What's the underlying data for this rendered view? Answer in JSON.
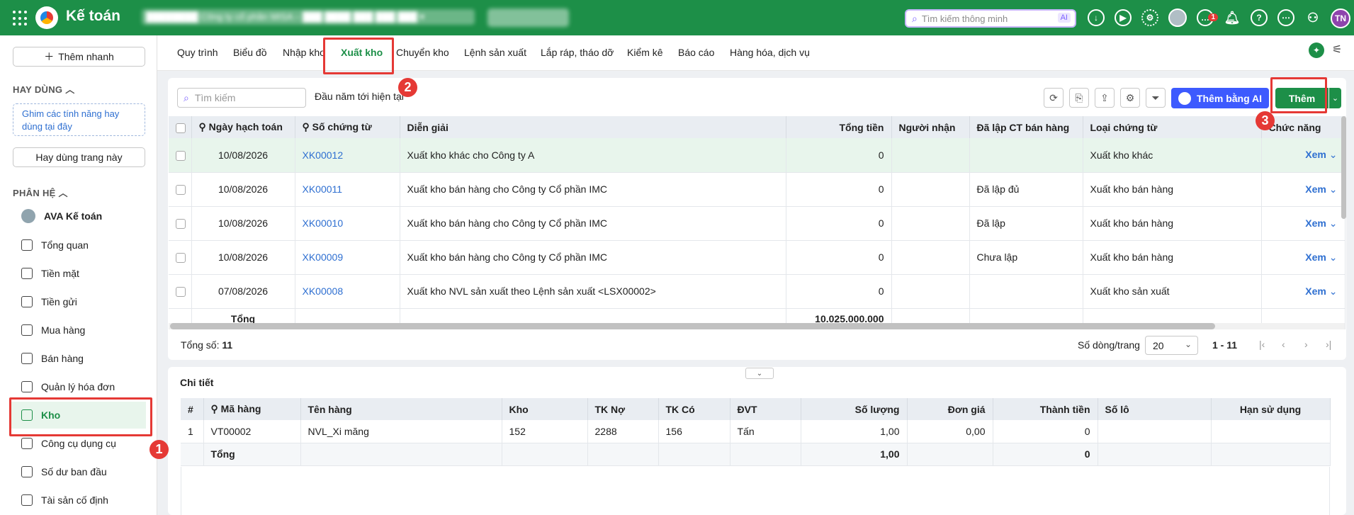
{
  "app": {
    "title": "Kế toán",
    "company_blurred": "████████ Công ty cổ phần MISA – ███ ████ ███ ███ ███ ▾",
    "year_blurred": "██ ████"
  },
  "search_smart": {
    "placeholder": "Tìm kiếm thông minh",
    "ai_label": "AI"
  },
  "notif_count": "1",
  "user_initials": "TN",
  "sidebar": {
    "quick_add": "Thêm nhanh",
    "favorites_label": "HAY DÙNG",
    "pin_hint": "Ghim các tính năng hay dùng tại đây",
    "favorites_button": "Hay dùng trang này",
    "modules_label": "PHÂN HỆ",
    "items": [
      {
        "label": "AVA Kế toán",
        "icon": "ava-avatar-icon"
      },
      {
        "label": "Tổng quan",
        "icon": "dashboard-icon"
      },
      {
        "label": "Tiền mặt",
        "icon": "cash-icon"
      },
      {
        "label": "Tiền gửi",
        "icon": "bank-icon"
      },
      {
        "label": "Mua hàng",
        "icon": "shopping-bag-icon"
      },
      {
        "label": "Bán hàng",
        "icon": "cart-icon"
      },
      {
        "label": "Quản lý hóa đơn",
        "icon": "invoice-icon"
      },
      {
        "label": "Kho",
        "icon": "warehouse-icon"
      },
      {
        "label": "Công cụ dụng cụ",
        "icon": "tools-icon"
      },
      {
        "label": "Số dư ban đầu",
        "icon": "document-icon"
      },
      {
        "label": "Tài sản cố định",
        "icon": "truck-icon"
      }
    ]
  },
  "tabs": [
    "Quy trình",
    "Biểu đồ",
    "Nhập kho",
    "Xuất kho",
    "Chuyển kho",
    "Lệnh sản xuất",
    "Lắp ráp, tháo dỡ",
    "Kiểm kê",
    "Báo cáo",
    "Hàng hóa, dịch vụ"
  ],
  "toolbar": {
    "search_placeholder": "Tìm kiếm",
    "period": "Đầu năm tới hiện tại",
    "ai_button": "Thêm bằng AI",
    "add_button": "Thêm"
  },
  "table": {
    "columns": [
      "Ngày hạch toán",
      "Số chứng từ",
      "Diễn giải",
      "Tổng tiền",
      "Người nhận",
      "Đã lập CT bán hàng",
      "Loại chứng từ",
      "Chức năng"
    ],
    "rows": [
      {
        "date": "10/08/2026",
        "no": "XK00012",
        "desc": "Xuất kho khác cho Công ty A",
        "total": "0",
        "receiver": "",
        "sales": "",
        "type": "Xuất kho khác",
        "action": "Xem"
      },
      {
        "date": "10/08/2026",
        "no": "XK00011",
        "desc": "Xuất kho bán hàng cho Công ty Cổ phần IMC",
        "total": "0",
        "receiver": "",
        "sales": "Đã lập đủ",
        "type": "Xuất kho bán hàng",
        "action": "Xem"
      },
      {
        "date": "10/08/2026",
        "no": "XK00010",
        "desc": "Xuất kho bán hàng cho Công ty Cổ phần IMC",
        "total": "0",
        "receiver": "",
        "sales": "Đã lập",
        "type": "Xuất kho bán hàng",
        "action": "Xem"
      },
      {
        "date": "10/08/2026",
        "no": "XK00009",
        "desc": "Xuất kho bán hàng cho Công ty Cổ phần IMC",
        "total": "0",
        "receiver": "",
        "sales": "Chưa lập",
        "type": "Xuất kho bán hàng",
        "action": "Xem"
      },
      {
        "date": "07/08/2026",
        "no": "XK00008",
        "desc": "Xuất kho NVL sản xuất theo Lệnh sản xuất <LSX00002>",
        "total": "0",
        "receiver": "",
        "sales": "",
        "type": "Xuất kho sản xuất",
        "action": "Xem"
      }
    ],
    "total_label": "Tổng",
    "total_value": "10.025.000.000"
  },
  "footer": {
    "total_label": "Tổng số:",
    "total_count": "11",
    "page_size_label": "Số dòng/trang",
    "page_size": "20",
    "range": "1 - 11"
  },
  "detail": {
    "title": "Chi tiết",
    "columns": [
      "#",
      "Mã hàng",
      "Tên hàng",
      "Kho",
      "TK Nợ",
      "TK Có",
      "ĐVT",
      "Số lượng",
      "Đơn giá",
      "Thành tiền",
      "Số lô",
      "Hạn sử dụng"
    ],
    "rows": [
      {
        "idx": "1",
        "code": "VT00002",
        "name": "NVL_Xi măng",
        "wh": "152",
        "debit": "2288",
        "credit": "156",
        "unit": "Tấn",
        "qty": "1,00",
        "price": "0,00",
        "amount": "0",
        "lot": "",
        "expiry": ""
      }
    ],
    "total_label": "Tổng",
    "total_qty": "1,00",
    "total_amount": "0"
  },
  "markers": [
    "1",
    "2",
    "3"
  ],
  "colors": {
    "brand": "#1d8f48",
    "accent_ai": "#3d5afe",
    "highlight": "#e53935",
    "link": "#2e6fd1"
  }
}
